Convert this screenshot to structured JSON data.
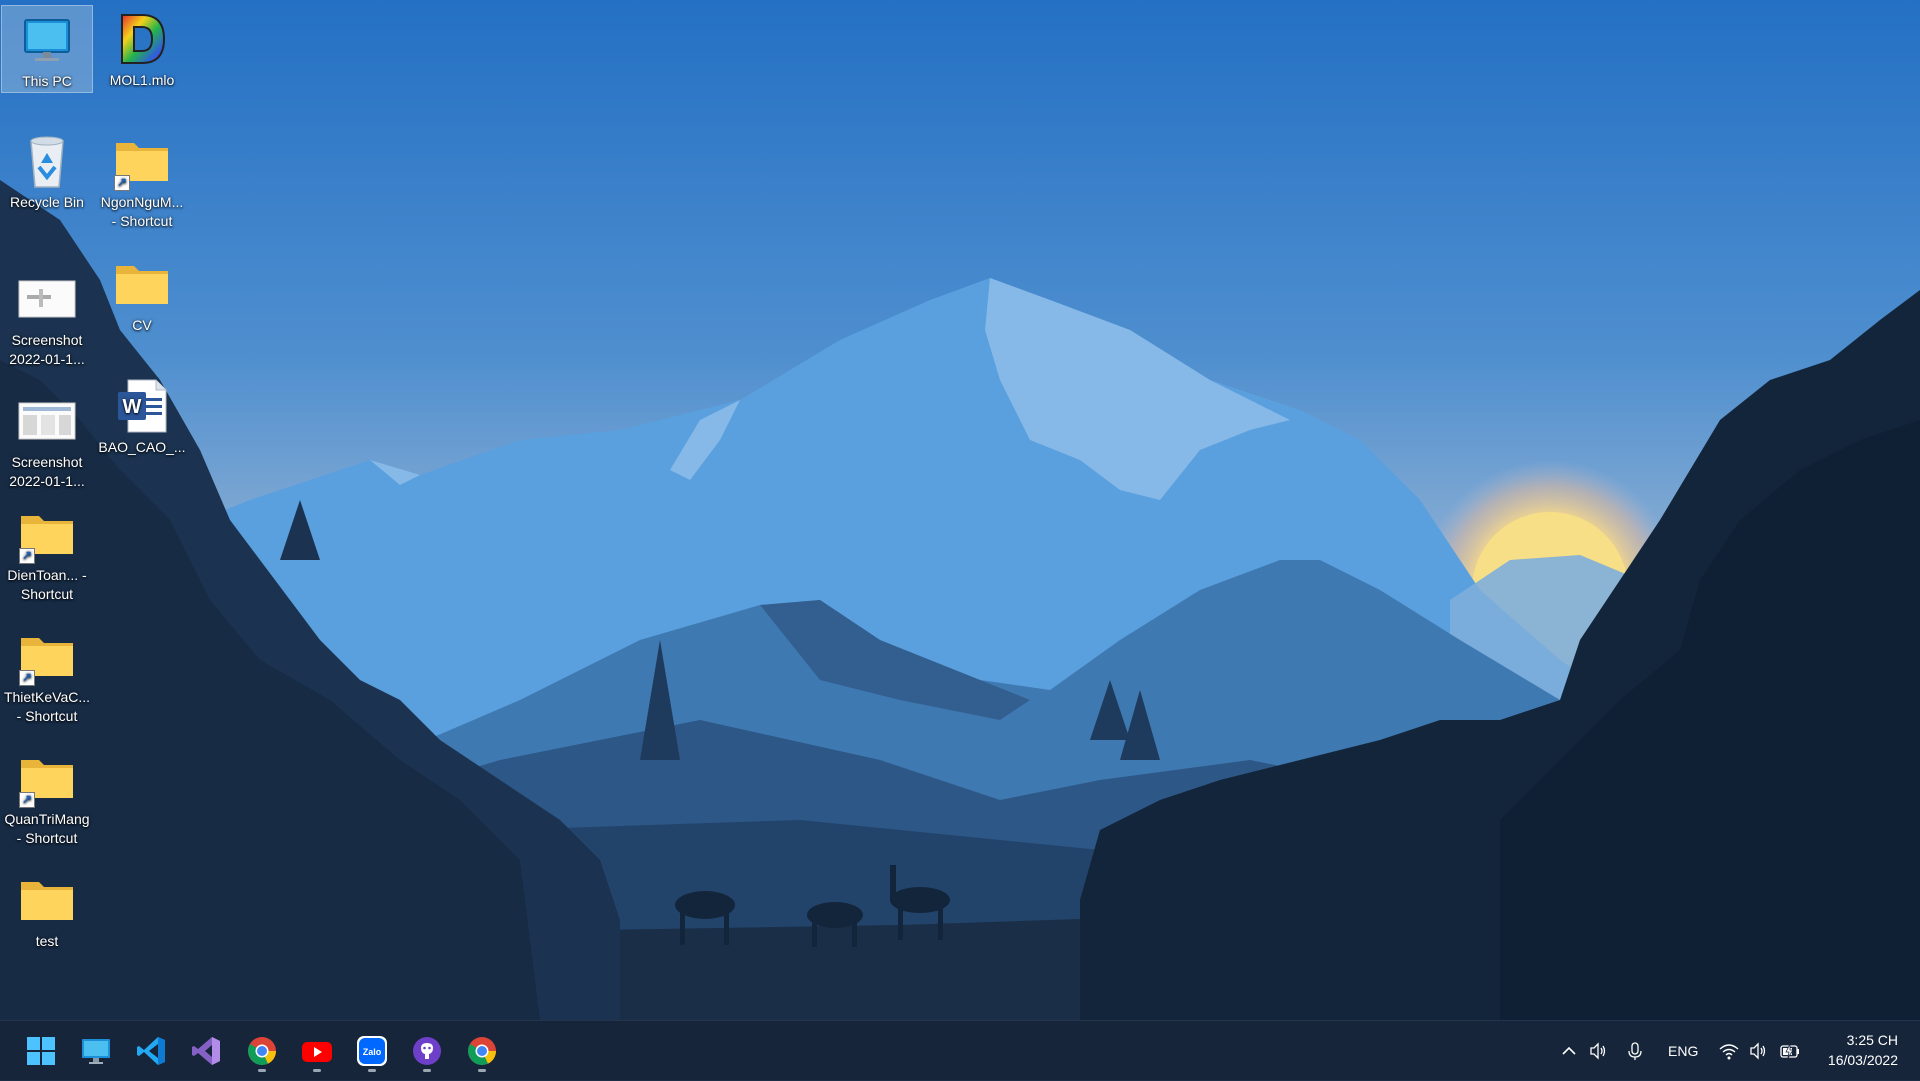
{
  "desktop": {
    "icons": [
      {
        "label": "This PC",
        "icon": "monitor-icon",
        "selected": true
      },
      {
        "label": "MOL1.mlo",
        "icon": "mol-file-icon"
      },
      {
        "label": "Recycle Bin",
        "icon": "recycle-bin-icon"
      },
      {
        "label": "NgonNguM... - Shortcut",
        "icon": "folder-shortcut-icon"
      },
      {
        "label": "Screenshot 2022-01-1...",
        "icon": "image-thumbnail-icon"
      },
      {
        "label": "CV",
        "icon": "folder-icon"
      },
      {
        "label": "Screenshot 2022-01-1...",
        "icon": "image-thumbnail-icon"
      },
      {
        "label": "BAO_CAO_...",
        "icon": "word-document-icon"
      },
      {
        "label": "DienToan... - Shortcut",
        "icon": "folder-shortcut-icon"
      },
      {
        "label": "ThietKeVaC... - Shortcut",
        "icon": "folder-shortcut-icon"
      },
      {
        "label": "QuanTriMang - Shortcut",
        "icon": "folder-shortcut-icon"
      },
      {
        "label": "test",
        "icon": "folder-icon"
      }
    ]
  },
  "taskbar": {
    "apps": [
      {
        "name": "start",
        "icon": "windows-start-icon"
      },
      {
        "name": "this-pc",
        "icon": "monitor-icon"
      },
      {
        "name": "vscode",
        "icon": "vscode-icon"
      },
      {
        "name": "visual-studio",
        "icon": "visual-studio-icon"
      },
      {
        "name": "chrome",
        "icon": "chrome-icon",
        "running": true
      },
      {
        "name": "youtube",
        "icon": "youtube-icon",
        "running": true
      },
      {
        "name": "zalo",
        "icon": "zalo-icon",
        "running": true
      },
      {
        "name": "github-desktop",
        "icon": "github-icon",
        "running": true
      },
      {
        "name": "chrome-2",
        "icon": "chrome-icon",
        "running": true
      }
    ],
    "zalo_text": "Zalo",
    "tray": {
      "language": "ENG",
      "time": "3:25 CH",
      "date": "16/03/2022"
    }
  }
}
